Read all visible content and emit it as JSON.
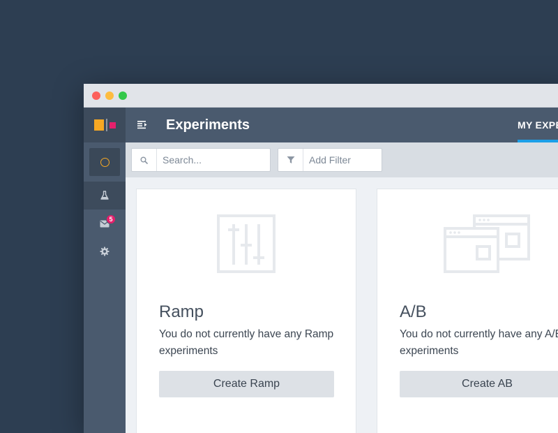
{
  "header": {
    "title": "Experiments",
    "active_tab": "MY EXPE"
  },
  "sidebar": {
    "notifications_count": "5",
    "items": [
      {
        "icon": "circle-status-icon"
      },
      {
        "icon": "flask-icon"
      },
      {
        "icon": "mail-icon"
      },
      {
        "icon": "gear-icon"
      }
    ]
  },
  "filters": {
    "search_placeholder": "Search...",
    "filter_placeholder": "Add Filter"
  },
  "cards": [
    {
      "title": "Ramp",
      "description": "You do not currently have any Ramp experiments",
      "button_label": "Create Ramp"
    },
    {
      "title": "A/B",
      "description": "You do not currently have any A/B experiments",
      "button_label": "Create AB"
    }
  ],
  "colors": {
    "background": "#2d3e52",
    "sidebar": "#4a5a6e",
    "accent_blue": "#1c9fe8",
    "logo_orange": "#f7a823",
    "logo_pink": "#e5206c"
  }
}
